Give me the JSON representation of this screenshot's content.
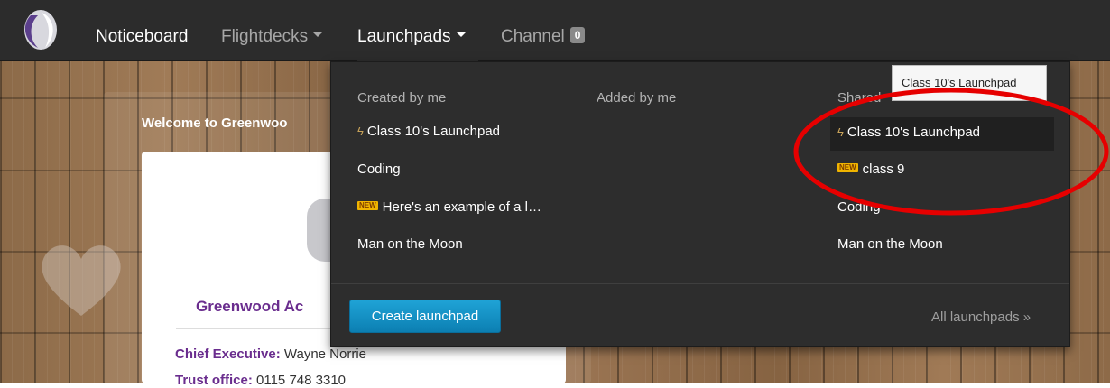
{
  "nav": {
    "items": [
      {
        "label": "Noticeboard"
      },
      {
        "label": "Flightdecks"
      },
      {
        "label": "Launchpads"
      },
      {
        "label": "Channel",
        "badge": "0"
      }
    ]
  },
  "page": {
    "welcome_title": "Welcome to Greenwoo",
    "school_name": "Greenwood Ac",
    "chief_label": "Chief Executive:",
    "chief_value": "Wayne Norrie",
    "trust_label": "Trust office:",
    "trust_value": "0115 748 3310"
  },
  "dropdown": {
    "columns": [
      "Created by me",
      "Added by me",
      "Shared"
    ],
    "created_by_me": [
      {
        "label": "Class 10's Launchpad",
        "icon": "bolt-icon"
      },
      {
        "label": "Coding"
      },
      {
        "label": "Here's an example of a l…",
        "badge": "NEW"
      },
      {
        "label": "Man on the Moon"
      }
    ],
    "shared": [
      {
        "label": "Class 10's Launchpad",
        "icon": "bolt-icon"
      },
      {
        "label": "class 9",
        "badge": "NEW"
      },
      {
        "label": "Coding"
      },
      {
        "label": "Man on the Moon"
      }
    ],
    "create_button": "Create launchpad",
    "all_link": "All launchpads »",
    "tooltip": "Class 10's Launchpad"
  },
  "colors": {
    "accent_blue": "#1493c7",
    "school_purple": "#6a2d8e",
    "new_badge": "#f0b400",
    "annotation_red": "#e60000"
  }
}
